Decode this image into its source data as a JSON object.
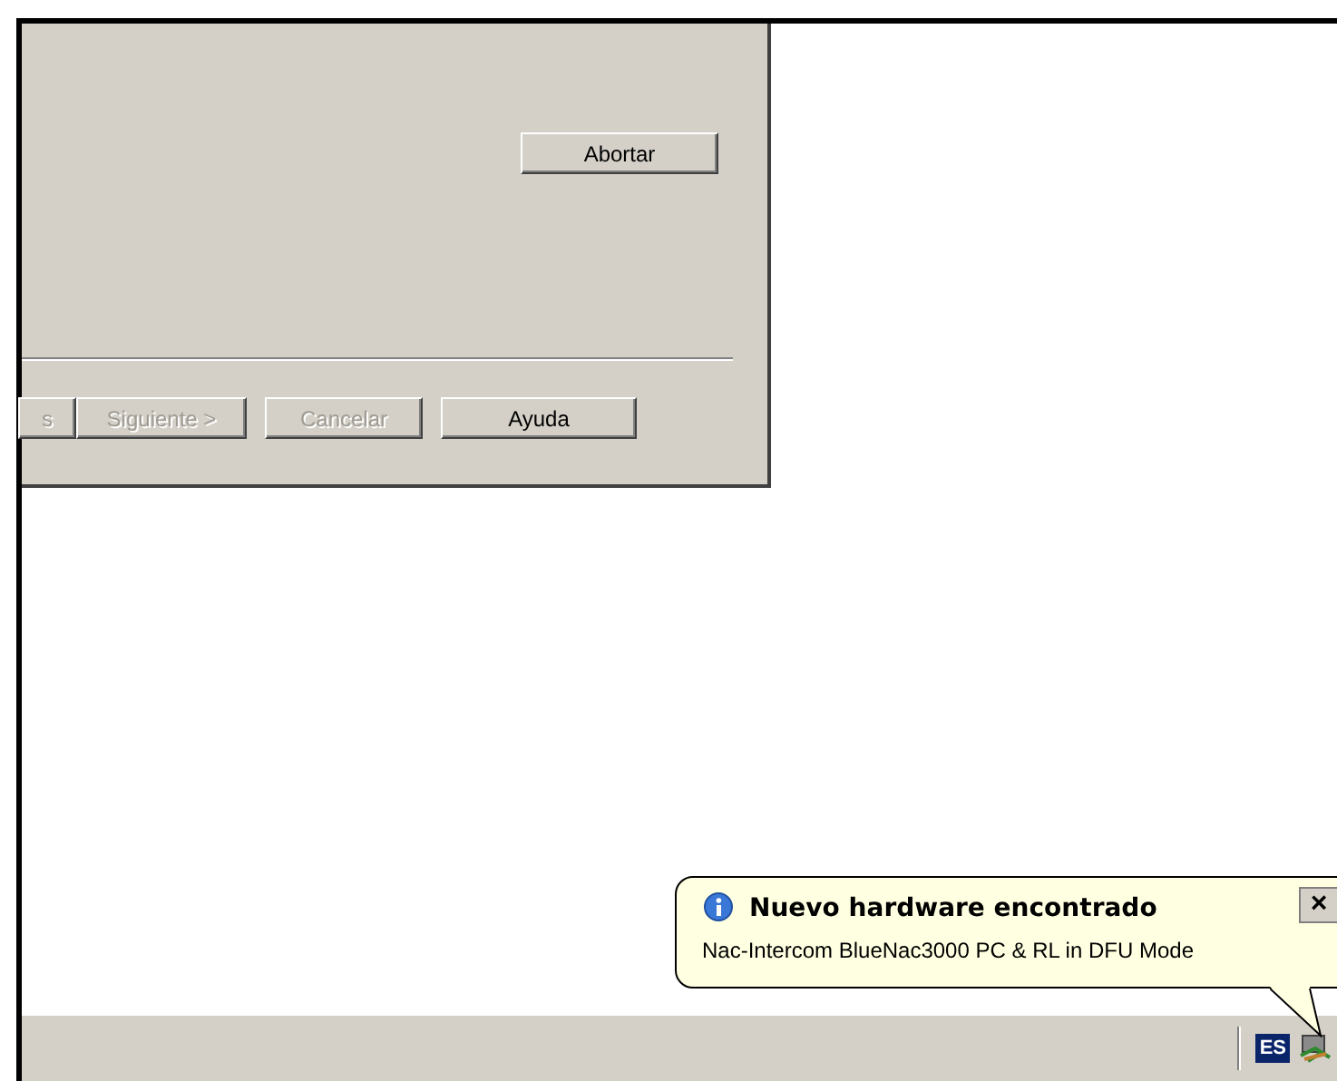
{
  "dialog": {
    "abort_button": {
      "label": "Abortar",
      "disabled": false
    },
    "buttons": [
      {
        "label": "s",
        "disabled": true
      },
      {
        "label": "Siguiente >",
        "disabled": true
      },
      {
        "label": "Cancelar",
        "disabled": true
      },
      {
        "label": "Ayuda",
        "disabled": false
      }
    ]
  },
  "balloon": {
    "title": "Nuevo hardware encontrado",
    "message": "Nac-Intercom BlueNac3000 PC & RL in DFU Mode",
    "close": "×"
  },
  "taskbar": {
    "language": "ES"
  }
}
